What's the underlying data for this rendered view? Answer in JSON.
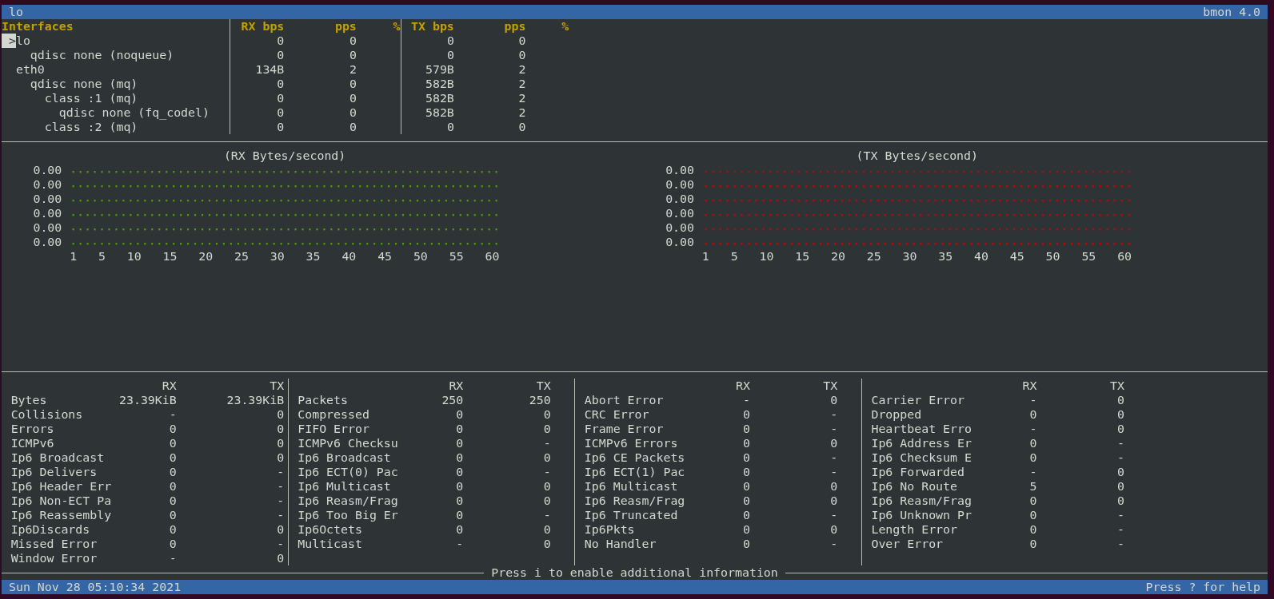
{
  "title_bar": {
    "title": "lo",
    "app": "bmon 4.0"
  },
  "interfaces": {
    "columns": [
      "Interfaces",
      "RX bps",
      "pps",
      "%",
      "TX bps",
      "pps",
      "%"
    ],
    "cursor": ">",
    "items": [
      {
        "name": "lo",
        "selected": true,
        "rx_bps": "0",
        "rx_pps": "0",
        "tx_bps": "0",
        "tx_pps": "0",
        "children": [
          {
            "name": "qdisc none (noqueue)",
            "selected": false,
            "rx_bps": "0",
            "rx_pps": "0",
            "tx_bps": "0",
            "tx_pps": "0"
          }
        ]
      },
      {
        "name": "eth0",
        "selected": false,
        "rx_bps": "134B",
        "rx_pps": "2",
        "tx_bps": "579B",
        "tx_pps": "2",
        "children": [
          {
            "name": "qdisc none (mq)",
            "selected": false,
            "rx_bps": "0",
            "rx_pps": "0",
            "tx_bps": "582B",
            "tx_pps": "2",
            "children": [
              {
                "name": "class :1 (mq)",
                "selected": false,
                "rx_bps": "0",
                "rx_pps": "0",
                "tx_bps": "582B",
                "tx_pps": "2",
                "children": [
                  {
                    "name": "qdisc none (fq_codel)",
                    "selected": false,
                    "rx_bps": "0",
                    "rx_pps": "0",
                    "tx_bps": "582B",
                    "tx_pps": "2"
                  }
                ]
              },
              {
                "name": "class :2 (mq)",
                "selected": false,
                "rx_bps": "0",
                "rx_pps": "0",
                "tx_bps": "0",
                "tx_pps": "0"
              }
            ]
          }
        ]
      }
    ]
  },
  "graphs": [
    {
      "title": "(RX Bytes/second)",
      "color": "#4e9a06",
      "y_labels": [
        "0.00",
        "0.00",
        "0.00",
        "0.00",
        "0.00",
        "0.00"
      ],
      "x_labels": [
        "1",
        "5",
        "10",
        "15",
        "20",
        "25",
        "30",
        "35",
        "40",
        "45",
        "50",
        "55",
        "60"
      ]
    },
    {
      "title": "(TX Bytes/second)",
      "color": "#cc0000",
      "y_labels": [
        "0.00",
        "0.00",
        "0.00",
        "0.00",
        "0.00",
        "0.00"
      ],
      "x_labels": [
        "1",
        "5",
        "10",
        "15",
        "20",
        "25",
        "30",
        "35",
        "40",
        "45",
        "50",
        "55",
        "60"
      ]
    }
  ],
  "stats_panels": [
    {
      "rx_label": "RX",
      "tx_label": "TX",
      "rows": [
        {
          "label": "Bytes",
          "rx": "23.39KiB",
          "tx": "23.39KiB"
        },
        {
          "label": "Collisions",
          "rx": "-",
          "tx": "0"
        },
        {
          "label": "Errors",
          "rx": "0",
          "tx": "0"
        },
        {
          "label": "ICMPv6",
          "rx": "0",
          "tx": "0"
        },
        {
          "label": "Ip6 Broadcast",
          "rx": "0",
          "tx": "0"
        },
        {
          "label": "Ip6 Delivers",
          "rx": "0",
          "tx": "-"
        },
        {
          "label": "Ip6 Header Err",
          "rx": "0",
          "tx": "-"
        },
        {
          "label": "Ip6 Non-ECT Pa",
          "rx": "0",
          "tx": "-"
        },
        {
          "label": "Ip6 Reassembly",
          "rx": "0",
          "tx": "-"
        },
        {
          "label": "Ip6Discards",
          "rx": "0",
          "tx": "0"
        },
        {
          "label": "Missed Error",
          "rx": "0",
          "tx": "-"
        },
        {
          "label": "Window Error",
          "rx": "-",
          "tx": "0"
        }
      ]
    },
    {
      "rx_label": "RX",
      "tx_label": "TX",
      "rows": [
        {
          "label": "Packets",
          "rx": "250",
          "tx": "250"
        },
        {
          "label": "Compressed",
          "rx": "0",
          "tx": "0"
        },
        {
          "label": "FIFO Error",
          "rx": "0",
          "tx": "0"
        },
        {
          "label": "ICMPv6 Checksu",
          "rx": "0",
          "tx": "-"
        },
        {
          "label": "Ip6 Broadcast",
          "rx": "0",
          "tx": "0"
        },
        {
          "label": "Ip6 ECT(0) Pac",
          "rx": "0",
          "tx": "-"
        },
        {
          "label": "Ip6 Multicast",
          "rx": "0",
          "tx": "0"
        },
        {
          "label": "Ip6 Reasm/Frag",
          "rx": "0",
          "tx": "0"
        },
        {
          "label": "Ip6 Too Big Er",
          "rx": "0",
          "tx": "-"
        },
        {
          "label": "Ip6Octets",
          "rx": "0",
          "tx": "0"
        },
        {
          "label": "Multicast",
          "rx": "-",
          "tx": "0"
        }
      ]
    },
    {
      "rx_label": "RX",
      "tx_label": "TX",
      "rows": [
        {
          "label": "Abort Error",
          "rx": "-",
          "tx": "0"
        },
        {
          "label": "CRC Error",
          "rx": "0",
          "tx": "-"
        },
        {
          "label": "Frame Error",
          "rx": "0",
          "tx": "-"
        },
        {
          "label": "ICMPv6 Errors",
          "rx": "0",
          "tx": "0"
        },
        {
          "label": "Ip6 CE Packets",
          "rx": "0",
          "tx": "-"
        },
        {
          "label": "Ip6 ECT(1) Pac",
          "rx": "0",
          "tx": "-"
        },
        {
          "label": "Ip6 Multicast",
          "rx": "0",
          "tx": "0"
        },
        {
          "label": "Ip6 Reasm/Frag",
          "rx": "0",
          "tx": "0"
        },
        {
          "label": "Ip6 Truncated",
          "rx": "0",
          "tx": "-"
        },
        {
          "label": "Ip6Pkts",
          "rx": "0",
          "tx": "0"
        },
        {
          "label": "No Handler",
          "rx": "0",
          "tx": "-"
        }
      ]
    },
    {
      "rx_label": "RX",
      "tx_label": "TX",
      "rows": [
        {
          "label": "Carrier Error",
          "rx": "-",
          "tx": "0"
        },
        {
          "label": "Dropped",
          "rx": "0",
          "tx": "0"
        },
        {
          "label": "Heartbeat Erro",
          "rx": "-",
          "tx": "0"
        },
        {
          "label": "Ip6 Address Er",
          "rx": "0",
          "tx": "-"
        },
        {
          "label": "Ip6 Checksum E",
          "rx": "0",
          "tx": "-"
        },
        {
          "label": "Ip6 Forwarded",
          "rx": "-",
          "tx": "0"
        },
        {
          "label": "Ip6 No Route",
          "rx": "5",
          "tx": "0"
        },
        {
          "label": "Ip6 Reasm/Frag",
          "rx": "0",
          "tx": "0"
        },
        {
          "label": "Ip6 Unknown Pr",
          "rx": "0",
          "tx": "-"
        },
        {
          "label": "Length Error",
          "rx": "0",
          "tx": "-"
        },
        {
          "label": "Over Error",
          "rx": "0",
          "tx": "-"
        }
      ]
    }
  ],
  "info_hint": "Press i to enable additional information",
  "status_bar": {
    "datetime": "Sun Nov 28 05:10:34 2021",
    "help": "Press ? for help"
  }
}
